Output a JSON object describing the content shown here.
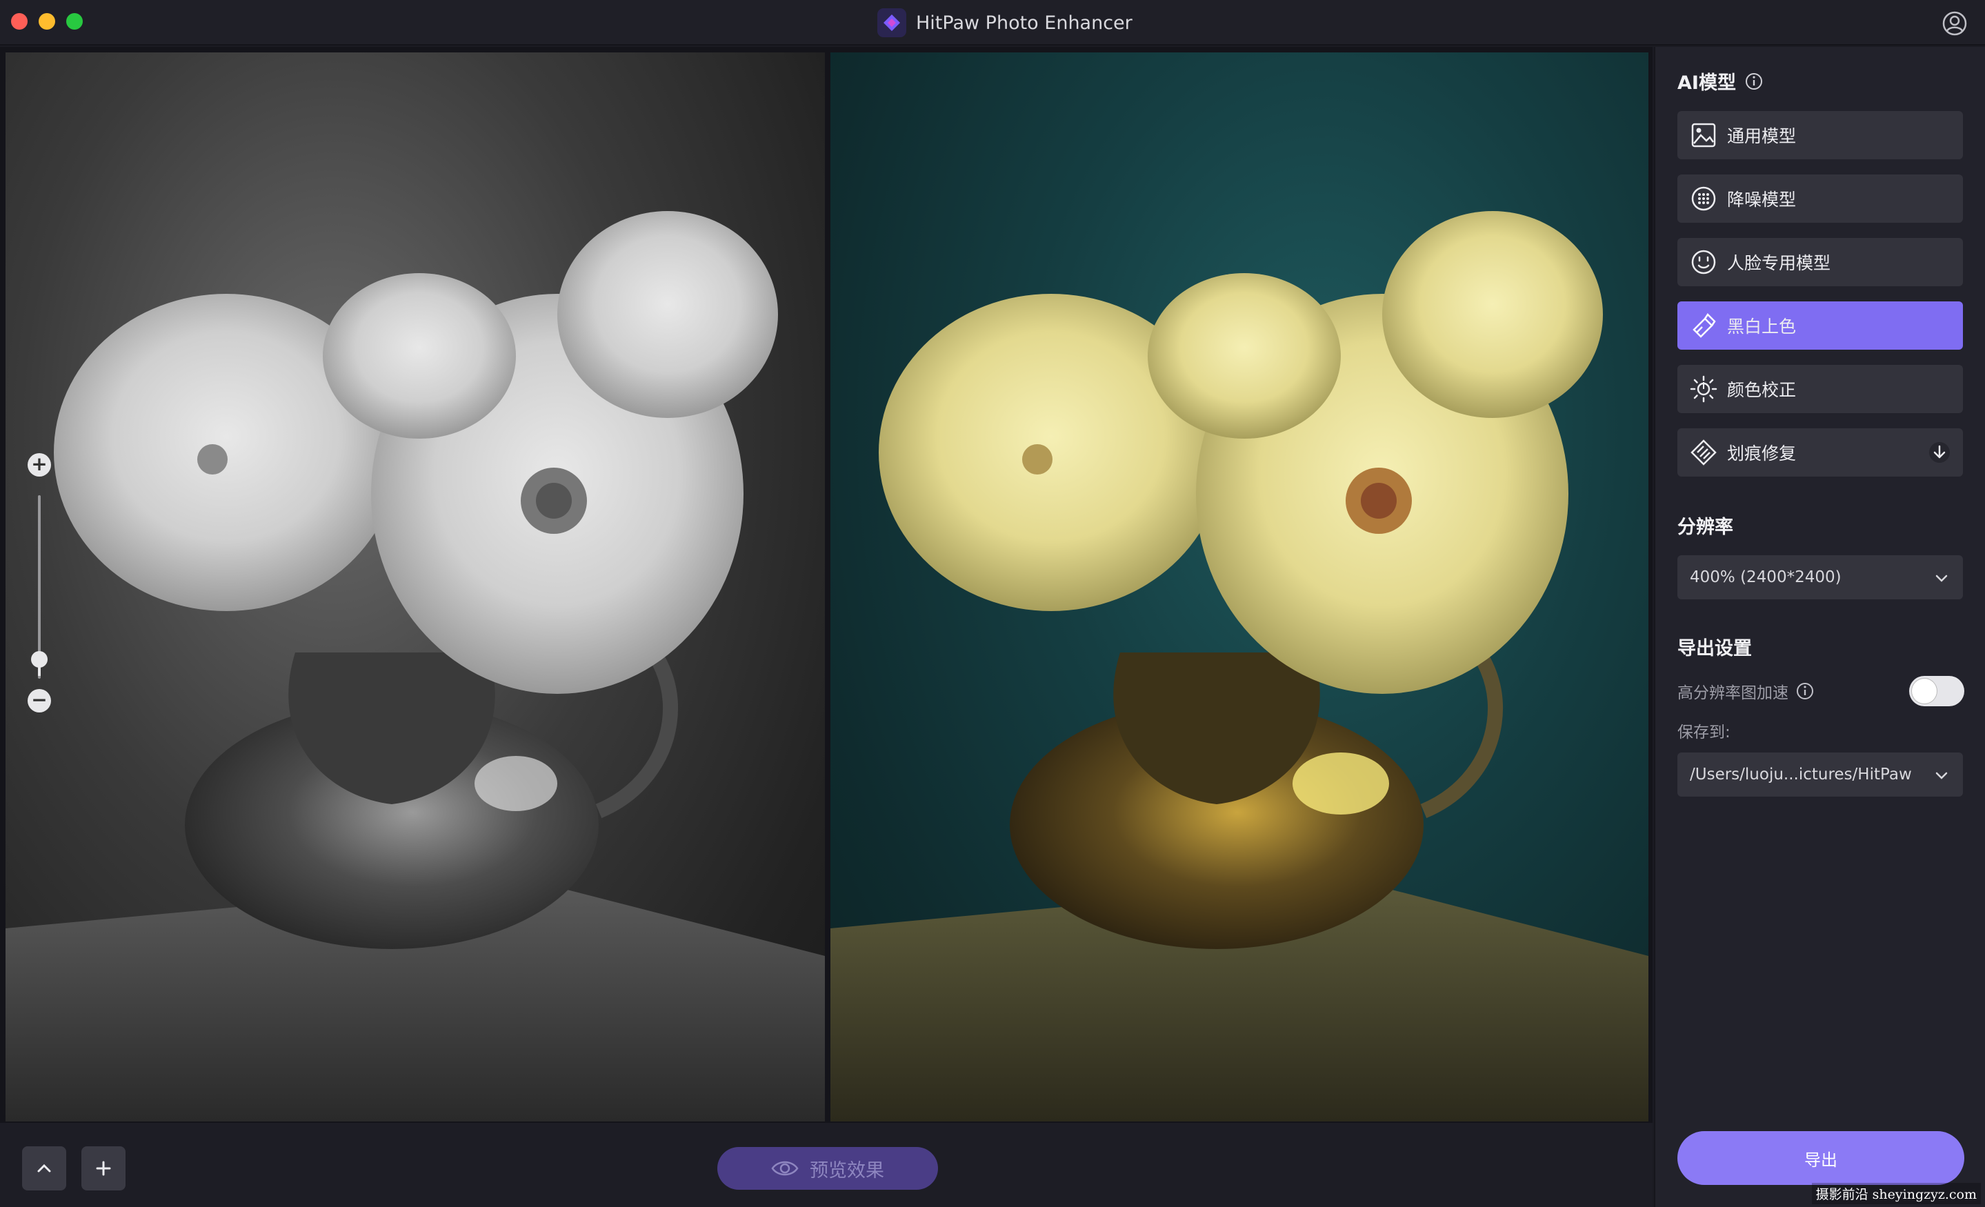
{
  "window": {
    "title": "HitPaw Photo Enhancer"
  },
  "sidebar": {
    "ai_model_title": "AI模型",
    "models": [
      {
        "label": "通用模型",
        "icon": "image-icon"
      },
      {
        "label": "降噪模型",
        "icon": "denoise-icon"
      },
      {
        "label": "人脸专用模型",
        "icon": "face-icon"
      },
      {
        "label": "黑白上色",
        "icon": "colorize-icon",
        "active": true
      },
      {
        "label": "颜色校正",
        "icon": "sun-icon"
      },
      {
        "label": "划痕修复",
        "icon": "scratch-icon",
        "download": true
      }
    ],
    "resolution_title": "分辨率",
    "resolution_value": "400% (2400*2400)",
    "export_settings_title": "导出设置",
    "hires_accel_label": "高分辨率图加速",
    "hires_accel_on": false,
    "save_to_label": "保存到:",
    "save_path": "/Users/luoju...ictures/HitPaw",
    "export_label": "导出"
  },
  "bottom": {
    "preview_label": "预览效果"
  },
  "zoom": {
    "level": 0.1
  },
  "watermark": "摄影前沿 sheyingzyz.com",
  "colors": {
    "accent": "#7f6df2",
    "export": "#8b7af5",
    "preview": "#4a3d86"
  }
}
